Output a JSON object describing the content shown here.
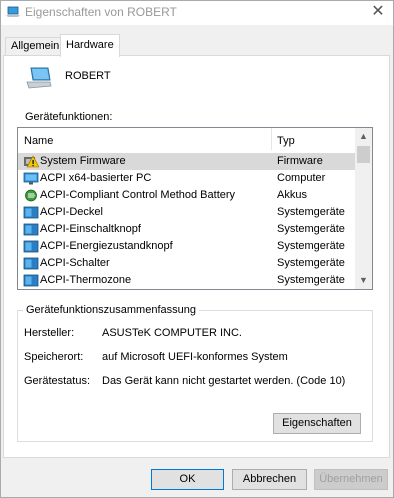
{
  "window": {
    "title": "Eigenschaften von ROBERT"
  },
  "tabs": [
    {
      "label": "Allgemein",
      "active": false
    },
    {
      "label": "Hardware",
      "active": true
    }
  ],
  "device": {
    "name": "ROBERT",
    "icon": "laptop-icon"
  },
  "functions": {
    "label": "Gerätefunktionen:",
    "columns": {
      "name": "Name",
      "type": "Typ"
    },
    "rows": [
      {
        "name": "System Firmware",
        "type": "Firmware",
        "icon": "firmware-warning-icon",
        "selected": true
      },
      {
        "name": "ACPI x64-basierter PC",
        "type": "Computer",
        "icon": "computer-icon"
      },
      {
        "name": "ACPI-Compliant Control Method Battery",
        "type": "Akkus",
        "icon": "battery-icon"
      },
      {
        "name": "ACPI-Deckel",
        "type": "Systemgeräte",
        "icon": "system-device-icon"
      },
      {
        "name": "ACPI-Einschaltknopf",
        "type": "Systemgeräte",
        "icon": "system-device-icon"
      },
      {
        "name": "ACPI-Energiezustandknopf",
        "type": "Systemgeräte",
        "icon": "system-device-icon"
      },
      {
        "name": "ACPI-Schalter",
        "type": "Systemgeräte",
        "icon": "system-device-icon"
      },
      {
        "name": "ACPI-Thermozone",
        "type": "Systemgeräte",
        "icon": "system-device-icon"
      }
    ]
  },
  "summary": {
    "title": "Gerätefunktionszusammenfassung",
    "manufacturer_label": "Hersteller:",
    "manufacturer_value": "ASUSTeK COMPUTER INC.",
    "location_label": "Speicherort:",
    "location_value": "auf Microsoft UEFI-konformes System",
    "status_label": "Gerätestatus:",
    "status_value": "Das Gerät kann nicht gestartet werden. (Code 10)",
    "properties_button": "Eigenschaften"
  },
  "buttons": {
    "ok": "OK",
    "cancel": "Abbrechen",
    "apply": "Übernehmen"
  },
  "colors": {
    "selection": "#d9d9d9",
    "accent": "#0078d7",
    "warning": "#f5c400"
  }
}
